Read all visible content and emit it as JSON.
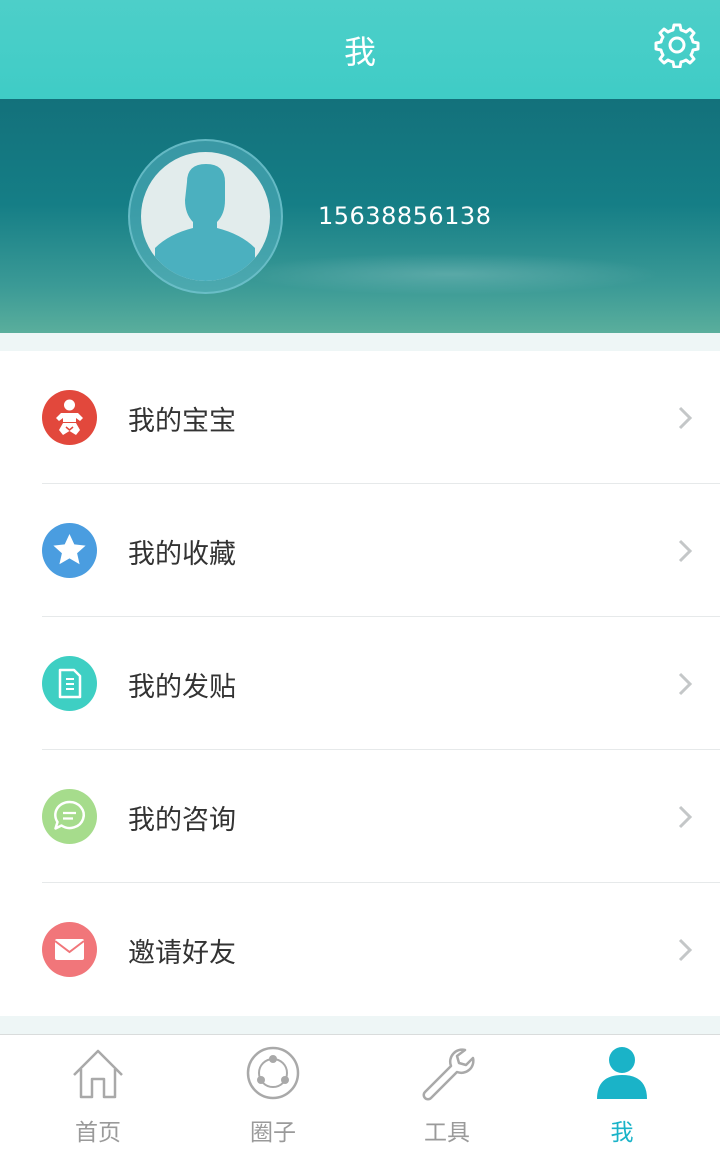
{
  "header": {
    "title": "我",
    "settings_icon": "gear-icon"
  },
  "profile": {
    "avatar_icon": "user-silhouette-icon",
    "phone": "15638856138"
  },
  "menu": [
    {
      "label": "我的宝宝",
      "icon": "baby-icon",
      "color": "#e2483c"
    },
    {
      "label": "我的收藏",
      "icon": "star-icon",
      "color": "#4a9de0"
    },
    {
      "label": "我的发贴",
      "icon": "document-icon",
      "color": "#3ecfc3"
    },
    {
      "label": "我的咨询",
      "icon": "chat-bubble-icon",
      "color": "#a6dc8c"
    },
    {
      "label": "邀请好友",
      "icon": "envelope-icon",
      "color": "#f1767a"
    }
  ],
  "tabs": [
    {
      "label": "首页",
      "icon": "home-icon",
      "active": false
    },
    {
      "label": "圈子",
      "icon": "circle-nodes-icon",
      "active": false
    },
    {
      "label": "工具",
      "icon": "wrench-icon",
      "active": false
    },
    {
      "label": "我",
      "icon": "person-icon",
      "active": true
    }
  ],
  "colors": {
    "accent": "#3fccc6",
    "active_tab": "#1ab3c8",
    "inactive_tab": "#9a9a9a"
  }
}
